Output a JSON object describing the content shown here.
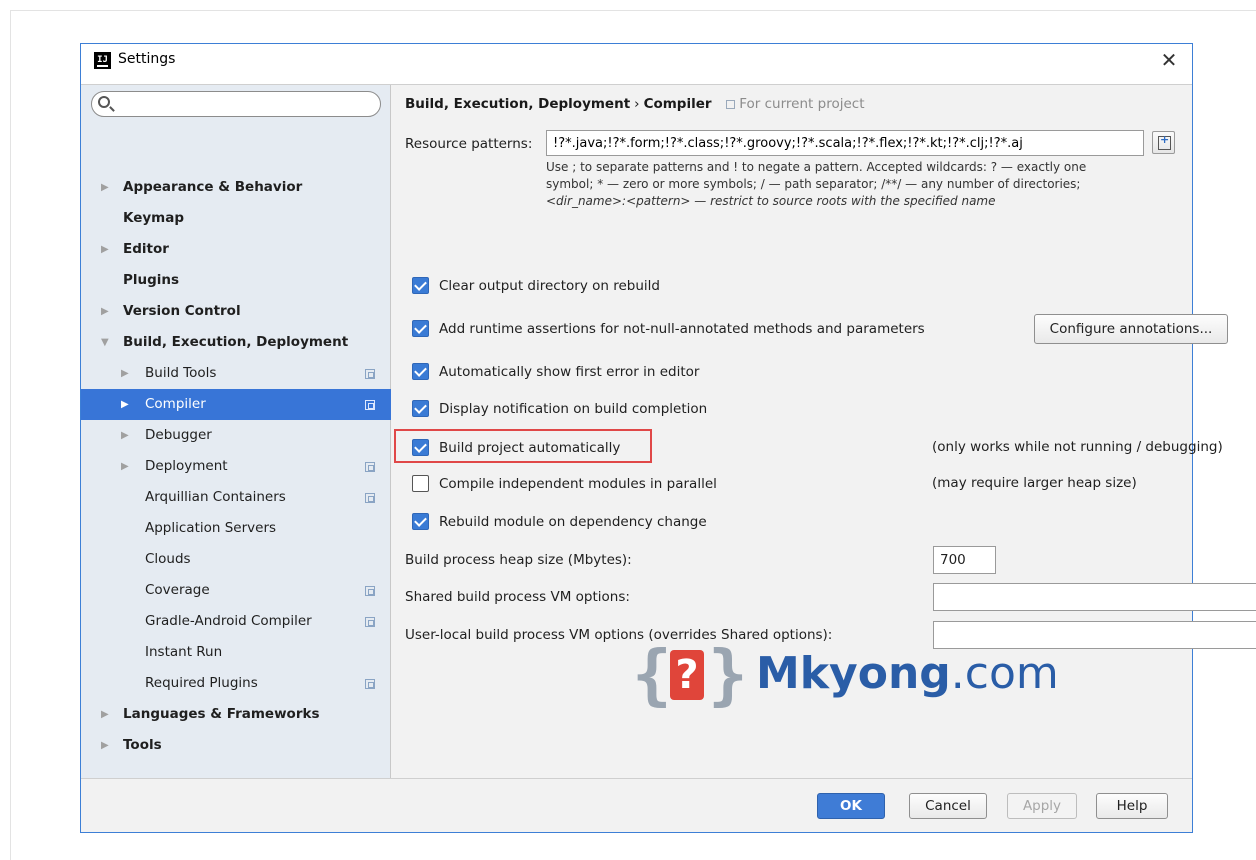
{
  "window": {
    "title": "Settings",
    "close_glyph": "✕"
  },
  "search": {
    "value": "",
    "placeholder": ""
  },
  "sidebar": {
    "items": [
      {
        "label": "Appearance & Behavior",
        "level": 0,
        "arrow": "▶"
      },
      {
        "label": "Keymap",
        "level": 0,
        "arrow": ""
      },
      {
        "label": "Editor",
        "level": 0,
        "arrow": "▶"
      },
      {
        "label": "Plugins",
        "level": 0,
        "arrow": ""
      },
      {
        "label": "Version Control",
        "level": 0,
        "arrow": "▶"
      },
      {
        "label": "Build, Execution, Deployment",
        "level": 0,
        "arrow": "▼"
      },
      {
        "label": "Build Tools",
        "level": 1,
        "arrow": "▶",
        "project_icon": true
      },
      {
        "label": "Compiler",
        "level": 1,
        "arrow": "▶",
        "project_icon": true,
        "selected": true
      },
      {
        "label": "Debugger",
        "level": 1,
        "arrow": "▶"
      },
      {
        "label": "Deployment",
        "level": 1,
        "arrow": "▶",
        "project_icon": true
      },
      {
        "label": "Arquillian Containers",
        "level": 1,
        "arrow": "",
        "project_icon": true
      },
      {
        "label": "Application Servers",
        "level": 1,
        "arrow": ""
      },
      {
        "label": "Clouds",
        "level": 1,
        "arrow": ""
      },
      {
        "label": "Coverage",
        "level": 1,
        "arrow": "",
        "project_icon": true
      },
      {
        "label": "Gradle-Android Compiler",
        "level": 1,
        "arrow": "",
        "project_icon": true
      },
      {
        "label": "Instant Run",
        "level": 1,
        "arrow": ""
      },
      {
        "label": "Required Plugins",
        "level": 1,
        "arrow": "",
        "project_icon": true
      },
      {
        "label": "Languages & Frameworks",
        "level": 0,
        "arrow": "▶"
      },
      {
        "label": "Tools",
        "level": 0,
        "arrow": "▶"
      }
    ]
  },
  "content": {
    "breadcrumb": {
      "parent": "Build, Execution, Deployment",
      "separator": "›",
      "current": "Compiler",
      "scope": "For current project"
    },
    "resource_patterns": {
      "label": "Resource patterns:",
      "value": "!?*.java;!?*.form;!?*.class;!?*.groovy;!?*.scala;!?*.flex;!?*.kt;!?*.clj;!?*.aj",
      "hint_lines": [
        "Use ; to separate patterns and ! to negate a pattern. Accepted wildcards: ? — exactly one",
        "symbol; * — zero or more symbols; / — path separator; /**/ — any number of directories;",
        "<dir_name>:<pattern> — restrict to source roots with the specified name"
      ]
    },
    "checkboxes": [
      {
        "label": "Clear output directory on rebuild",
        "checked": true
      },
      {
        "label": "Add runtime assertions for not-null-annotated methods and parameters",
        "checked": true
      },
      {
        "label": "Automatically show first error in editor",
        "checked": true
      },
      {
        "label": "Display notification on build completion",
        "checked": true
      },
      {
        "label": "Build project automatically",
        "checked": true
      },
      {
        "label": "Compile independent modules in parallel",
        "checked": false
      },
      {
        "label": "Rebuild module on dependency change",
        "checked": true
      }
    ],
    "configure_annotations_label": "Configure annotations...",
    "notes": {
      "build_auto": "(only works while not running / debugging)",
      "parallel": "(may require larger heap size)"
    },
    "heap": {
      "label": "Build process heap size (Mbytes):",
      "value": "700"
    },
    "shared_vm": {
      "label": "Shared build process VM options:",
      "value": ""
    },
    "user_vm": {
      "label": "User-local build process VM options (overrides Shared options):",
      "value": ""
    },
    "watermark": {
      "brace_left": "{",
      "mark": "?",
      "brace_right": "}",
      "brand_bold": "Mkyong",
      "brand_rest": ".com"
    }
  },
  "footer": {
    "ok": "OK",
    "cancel": "Cancel",
    "apply": "Apply",
    "help": "Help"
  },
  "colors": {
    "accent": "#3875d7",
    "highlight": "#e04848",
    "sidebar_bg": "#e5ebf2"
  }
}
